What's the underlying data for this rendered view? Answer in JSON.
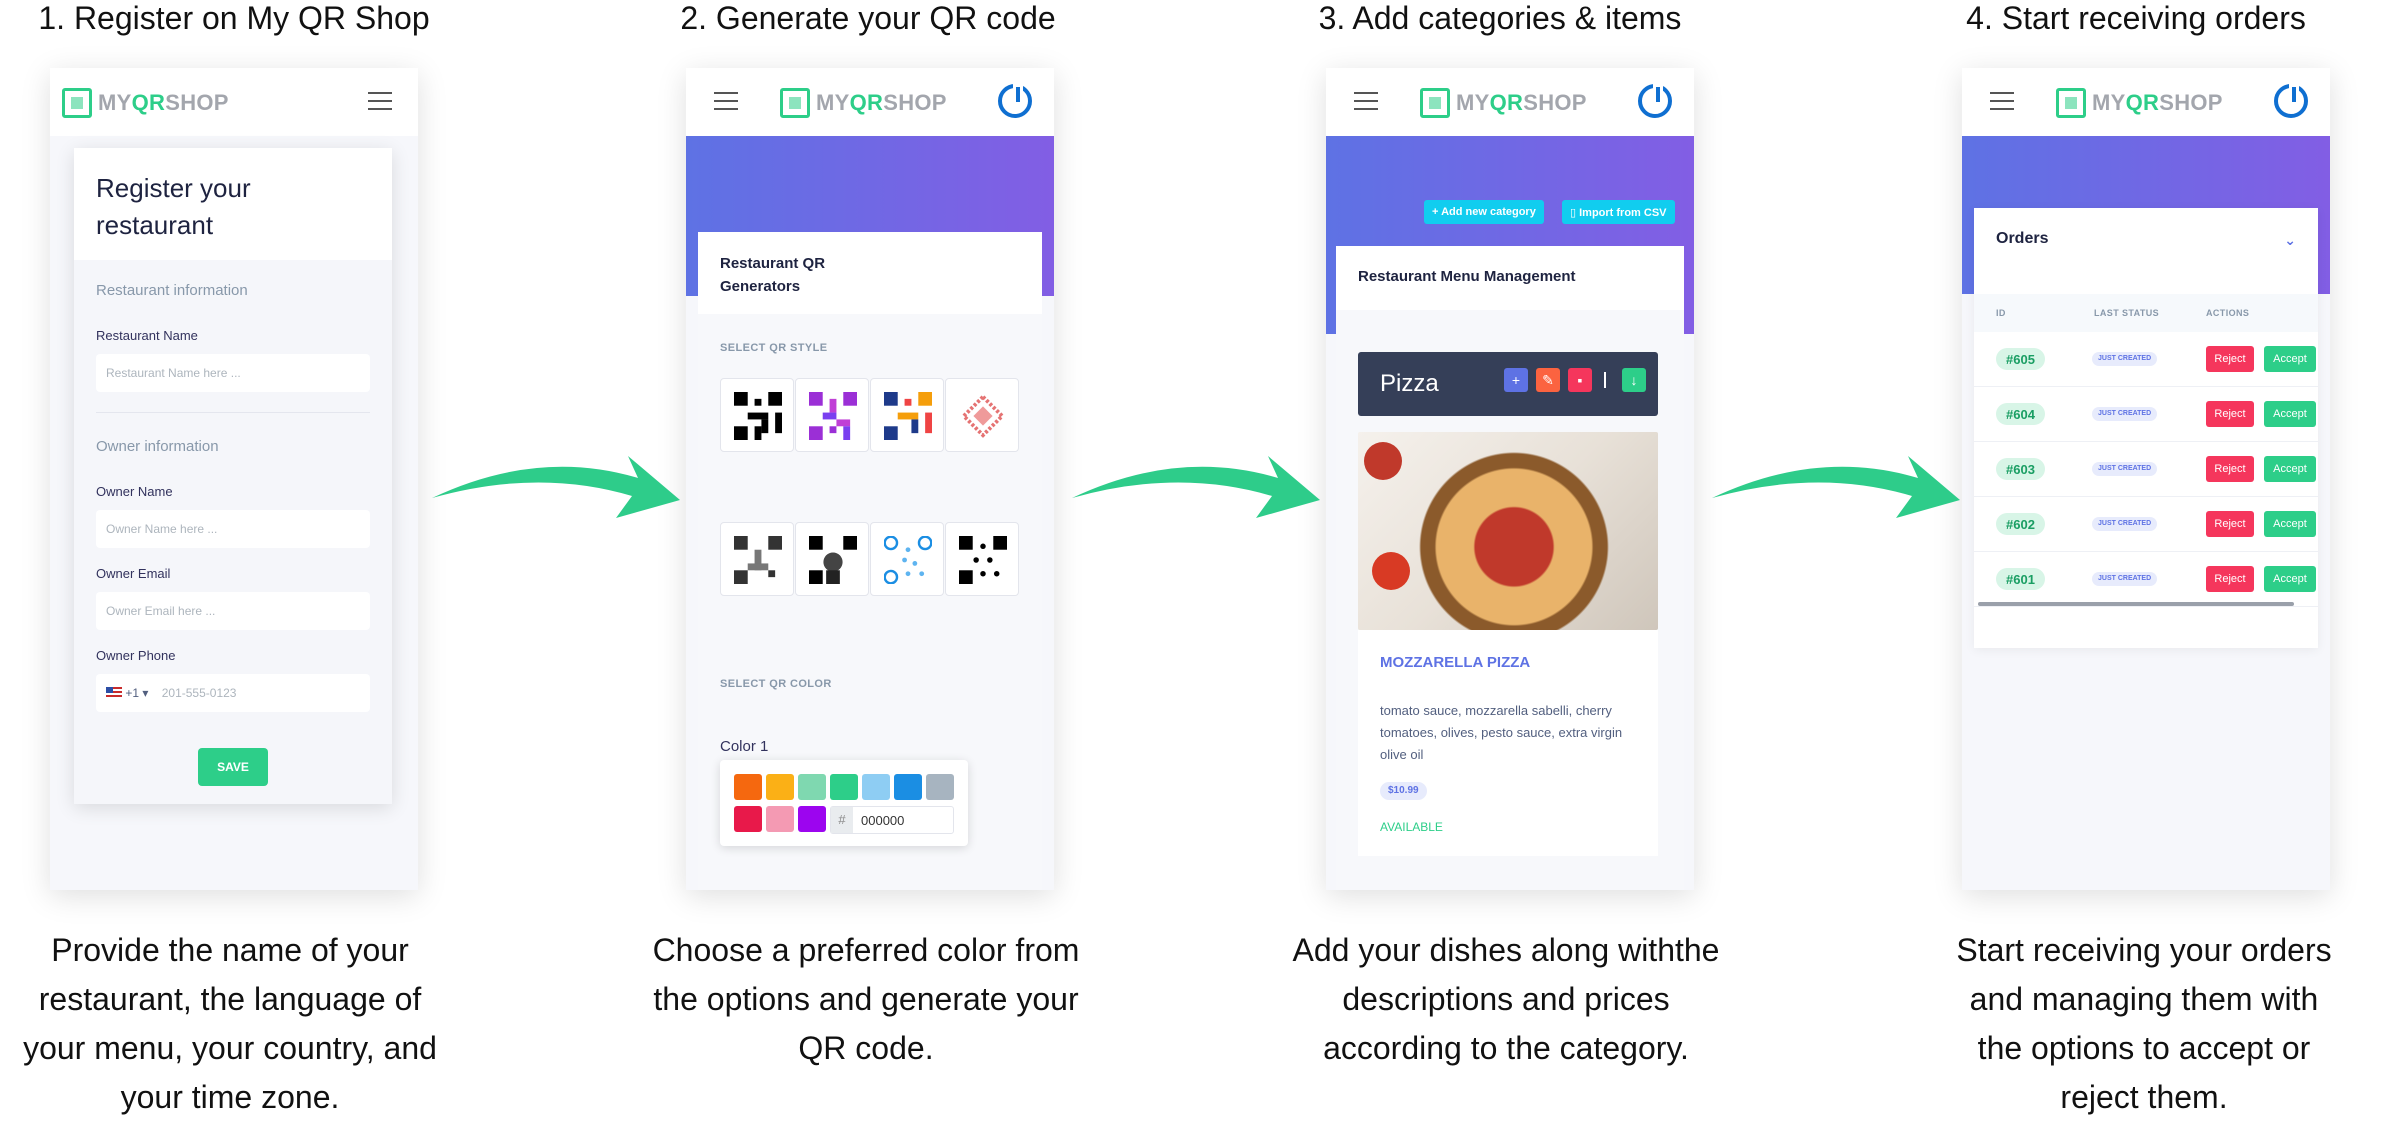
{
  "steps": [
    {
      "title": "1. Register on My QR Shop",
      "caption": [
        "Provide the name of your",
        "restaurant, the language of",
        "your menu, your country, and",
        "your time zone."
      ]
    },
    {
      "title": "2. Generate your QR code",
      "caption": [
        "Choose a preferred color from",
        "the options and generate your",
        "QR code."
      ]
    },
    {
      "title": "3. Add categories & items",
      "caption": [
        "Add your dishes along withthe",
        "descriptions and prices",
        "according to the category."
      ]
    },
    {
      "title": "4. Start receiving orders",
      "caption": [
        "Start receiving your orders",
        "and managing them with",
        "the options to accept or",
        "reject them."
      ]
    }
  ],
  "logo": {
    "my": "MY",
    "qr": "QR",
    "shop": "SHOP"
  },
  "register": {
    "heading_line1": "Register your",
    "heading_line2": "restaurant",
    "section1": "Restaurant information",
    "name_label": "Restaurant Name",
    "name_placeholder": "Restaurant Name here ...",
    "section2": "Owner information",
    "owner_label": "Owner Name",
    "owner_placeholder": "Owner Name here ...",
    "email_label": "Owner Email",
    "email_placeholder": "Owner Email here ...",
    "phone_label": "Owner Phone",
    "phone_code": "+1 ▾",
    "phone_placeholder": "201-555-0123",
    "save": "SAVE"
  },
  "qr": {
    "heading_line1": "Restaurant QR",
    "heading_line2": "Generators",
    "style_label": "SELECT QR STYLE",
    "color_label": "SELECT QR COLOR",
    "color1": "Color 1",
    "hex_value": "000000",
    "swatches": [
      "#f5680f",
      "#fbb016",
      "#7fd8b0",
      "#2dce89",
      "#8ecdf3",
      "#1b8ee3",
      "#a7b4c0",
      "#e8194a",
      "#f49ab3",
      "#9c05ef"
    ],
    "styles": [
      "classic",
      "purple-dots",
      "gradient",
      "diamond",
      "squares",
      "portrait",
      "blue-circles",
      "dots"
    ]
  },
  "menu": {
    "add_category": "+ Add new category",
    "import_csv": "Import from CSV",
    "heading": "Restaurant Menu Management",
    "category": "Pizza",
    "item_name": "MOZZARELLA PIZZA",
    "item_desc": "tomato sauce, mozzarella sabelli, cherry tomatoes, olives, pesto sauce, extra virgin olive oil",
    "price": "$10.99",
    "status": "AVAILABLE"
  },
  "orders": {
    "heading": "Orders",
    "col_id": "ID",
    "col_status": "LAST STATUS",
    "col_actions": "ACTIONS",
    "reject": "Reject",
    "accept": "Accept",
    "rows": [
      {
        "id": "#605",
        "status": "JUST CREATED"
      },
      {
        "id": "#604",
        "status": "JUST CREATED"
      },
      {
        "id": "#603",
        "status": "JUST CREATED"
      },
      {
        "id": "#602",
        "status": "JUST CREATED"
      },
      {
        "id": "#601",
        "status": "JUST CREATED"
      }
    ]
  },
  "colors": {
    "accent_green": "#2dce89",
    "gradient_start": "#5e72e4",
    "gradient_end": "#825ee4",
    "arrow": "#2ecc8a"
  }
}
